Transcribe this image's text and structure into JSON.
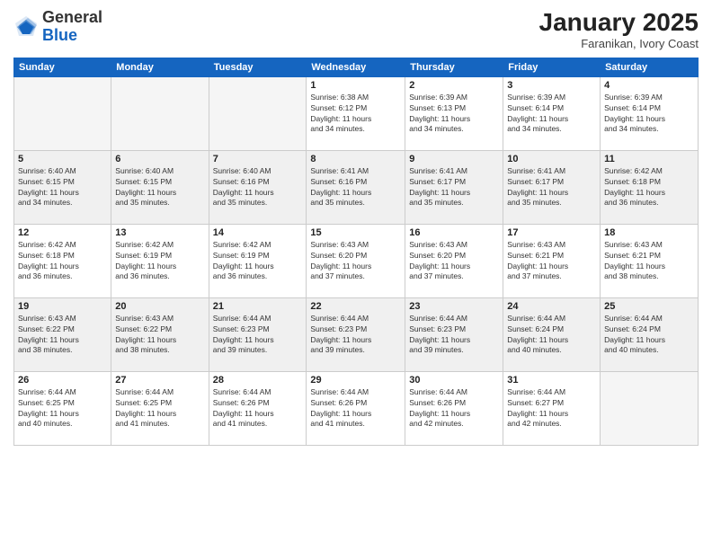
{
  "header": {
    "logo_general": "General",
    "logo_blue": "Blue",
    "month_title": "January 2025",
    "subtitle": "Faranikan, Ivory Coast"
  },
  "days_of_week": [
    "Sunday",
    "Monday",
    "Tuesday",
    "Wednesday",
    "Thursday",
    "Friday",
    "Saturday"
  ],
  "weeks": [
    [
      {
        "day": "",
        "info": ""
      },
      {
        "day": "",
        "info": ""
      },
      {
        "day": "",
        "info": ""
      },
      {
        "day": "1",
        "info": "Sunrise: 6:38 AM\nSunset: 6:12 PM\nDaylight: 11 hours\nand 34 minutes."
      },
      {
        "day": "2",
        "info": "Sunrise: 6:39 AM\nSunset: 6:13 PM\nDaylight: 11 hours\nand 34 minutes."
      },
      {
        "day": "3",
        "info": "Sunrise: 6:39 AM\nSunset: 6:14 PM\nDaylight: 11 hours\nand 34 minutes."
      },
      {
        "day": "4",
        "info": "Sunrise: 6:39 AM\nSunset: 6:14 PM\nDaylight: 11 hours\nand 34 minutes."
      }
    ],
    [
      {
        "day": "5",
        "info": "Sunrise: 6:40 AM\nSunset: 6:15 PM\nDaylight: 11 hours\nand 34 minutes."
      },
      {
        "day": "6",
        "info": "Sunrise: 6:40 AM\nSunset: 6:15 PM\nDaylight: 11 hours\nand 35 minutes."
      },
      {
        "day": "7",
        "info": "Sunrise: 6:40 AM\nSunset: 6:16 PM\nDaylight: 11 hours\nand 35 minutes."
      },
      {
        "day": "8",
        "info": "Sunrise: 6:41 AM\nSunset: 6:16 PM\nDaylight: 11 hours\nand 35 minutes."
      },
      {
        "day": "9",
        "info": "Sunrise: 6:41 AM\nSunset: 6:17 PM\nDaylight: 11 hours\nand 35 minutes."
      },
      {
        "day": "10",
        "info": "Sunrise: 6:41 AM\nSunset: 6:17 PM\nDaylight: 11 hours\nand 35 minutes."
      },
      {
        "day": "11",
        "info": "Sunrise: 6:42 AM\nSunset: 6:18 PM\nDaylight: 11 hours\nand 36 minutes."
      }
    ],
    [
      {
        "day": "12",
        "info": "Sunrise: 6:42 AM\nSunset: 6:18 PM\nDaylight: 11 hours\nand 36 minutes."
      },
      {
        "day": "13",
        "info": "Sunrise: 6:42 AM\nSunset: 6:19 PM\nDaylight: 11 hours\nand 36 minutes."
      },
      {
        "day": "14",
        "info": "Sunrise: 6:42 AM\nSunset: 6:19 PM\nDaylight: 11 hours\nand 36 minutes."
      },
      {
        "day": "15",
        "info": "Sunrise: 6:43 AM\nSunset: 6:20 PM\nDaylight: 11 hours\nand 37 minutes."
      },
      {
        "day": "16",
        "info": "Sunrise: 6:43 AM\nSunset: 6:20 PM\nDaylight: 11 hours\nand 37 minutes."
      },
      {
        "day": "17",
        "info": "Sunrise: 6:43 AM\nSunset: 6:21 PM\nDaylight: 11 hours\nand 37 minutes."
      },
      {
        "day": "18",
        "info": "Sunrise: 6:43 AM\nSunset: 6:21 PM\nDaylight: 11 hours\nand 38 minutes."
      }
    ],
    [
      {
        "day": "19",
        "info": "Sunrise: 6:43 AM\nSunset: 6:22 PM\nDaylight: 11 hours\nand 38 minutes."
      },
      {
        "day": "20",
        "info": "Sunrise: 6:43 AM\nSunset: 6:22 PM\nDaylight: 11 hours\nand 38 minutes."
      },
      {
        "day": "21",
        "info": "Sunrise: 6:44 AM\nSunset: 6:23 PM\nDaylight: 11 hours\nand 39 minutes."
      },
      {
        "day": "22",
        "info": "Sunrise: 6:44 AM\nSunset: 6:23 PM\nDaylight: 11 hours\nand 39 minutes."
      },
      {
        "day": "23",
        "info": "Sunrise: 6:44 AM\nSunset: 6:23 PM\nDaylight: 11 hours\nand 39 minutes."
      },
      {
        "day": "24",
        "info": "Sunrise: 6:44 AM\nSunset: 6:24 PM\nDaylight: 11 hours\nand 40 minutes."
      },
      {
        "day": "25",
        "info": "Sunrise: 6:44 AM\nSunset: 6:24 PM\nDaylight: 11 hours\nand 40 minutes."
      }
    ],
    [
      {
        "day": "26",
        "info": "Sunrise: 6:44 AM\nSunset: 6:25 PM\nDaylight: 11 hours\nand 40 minutes."
      },
      {
        "day": "27",
        "info": "Sunrise: 6:44 AM\nSunset: 6:25 PM\nDaylight: 11 hours\nand 41 minutes."
      },
      {
        "day": "28",
        "info": "Sunrise: 6:44 AM\nSunset: 6:26 PM\nDaylight: 11 hours\nand 41 minutes."
      },
      {
        "day": "29",
        "info": "Sunrise: 6:44 AM\nSunset: 6:26 PM\nDaylight: 11 hours\nand 41 minutes."
      },
      {
        "day": "30",
        "info": "Sunrise: 6:44 AM\nSunset: 6:26 PM\nDaylight: 11 hours\nand 42 minutes."
      },
      {
        "day": "31",
        "info": "Sunrise: 6:44 AM\nSunset: 6:27 PM\nDaylight: 11 hours\nand 42 minutes."
      },
      {
        "day": "",
        "info": ""
      }
    ]
  ]
}
